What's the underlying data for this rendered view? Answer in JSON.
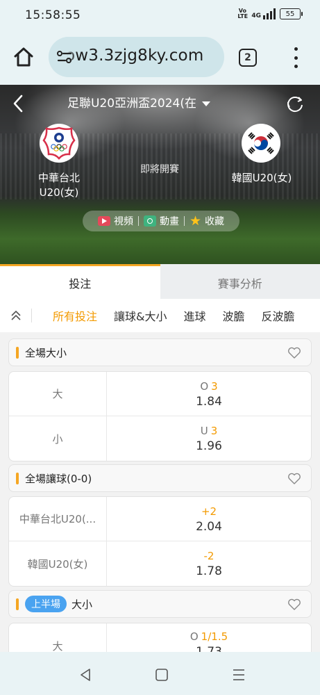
{
  "status_bar": {
    "time": "15:58:55",
    "volte": "Vo LTE",
    "network": "4G",
    "battery": "55"
  },
  "browser": {
    "url": "ow3.3zjg8ky.com",
    "tab_count": "2"
  },
  "match": {
    "league": "足聯U20亞洲盃2024(在",
    "status": "即將開賽",
    "home_team": "中華台北U20(女)",
    "home_team_line1": "中華台北",
    "home_team_line2": "U20(女)",
    "away_team": "韓國U20(女)",
    "media": {
      "video": "視頻",
      "animation": "動畫",
      "favorite": "收藏"
    }
  },
  "main_tabs": [
    {
      "label": "投注",
      "active": true
    },
    {
      "label": "賽事分析",
      "active": false
    }
  ],
  "sub_tabs": [
    {
      "label": "所有投注",
      "active": true
    },
    {
      "label": "讓球&大小",
      "active": false
    },
    {
      "label": "進球",
      "active": false
    },
    {
      "label": "波膽",
      "active": false
    },
    {
      "label": "反波膽",
      "active": false
    }
  ],
  "markets": [
    {
      "title": "全場大小",
      "chip": "",
      "rows": [
        {
          "label": "大",
          "side": "O",
          "line": "3",
          "price": "1.84"
        },
        {
          "label": "小",
          "side": "U",
          "line": "3",
          "price": "1.96"
        }
      ]
    },
    {
      "title": "全場讓球(0-0)",
      "chip": "",
      "rows": [
        {
          "label": "中華台北U20(...",
          "side": "",
          "line": "+2",
          "price": "2.04"
        },
        {
          "label": "韓國U20(女)",
          "side": "",
          "line": "-2",
          "price": "1.78"
        }
      ]
    },
    {
      "title": "大小",
      "chip": "上半場",
      "rows": [
        {
          "label": "大",
          "side": "O",
          "line": "1/1.5",
          "price": "1.73"
        }
      ]
    }
  ],
  "colors": {
    "accent": "#f39a00",
    "chip": "#4aa3f0",
    "browser_bg": "#e9f3f5"
  }
}
